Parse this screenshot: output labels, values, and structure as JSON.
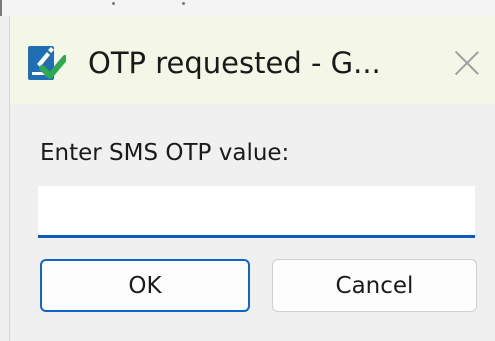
{
  "window": {
    "title": "OTP requested - G...",
    "app_icon": "green-check-document-icon",
    "close_icon": "close-icon"
  },
  "form": {
    "prompt": "Enter SMS OTP value:",
    "otp_value": "",
    "otp_placeholder": ""
  },
  "buttons": {
    "ok_label": "OK",
    "cancel_label": "Cancel"
  },
  "colors": {
    "titlebar_bg": "#f4f7e8",
    "dialog_bg": "#f0f0f0",
    "accent": "#1066c8",
    "icon_green": "#2fa84f",
    "icon_blue": "#1f6fb2"
  }
}
